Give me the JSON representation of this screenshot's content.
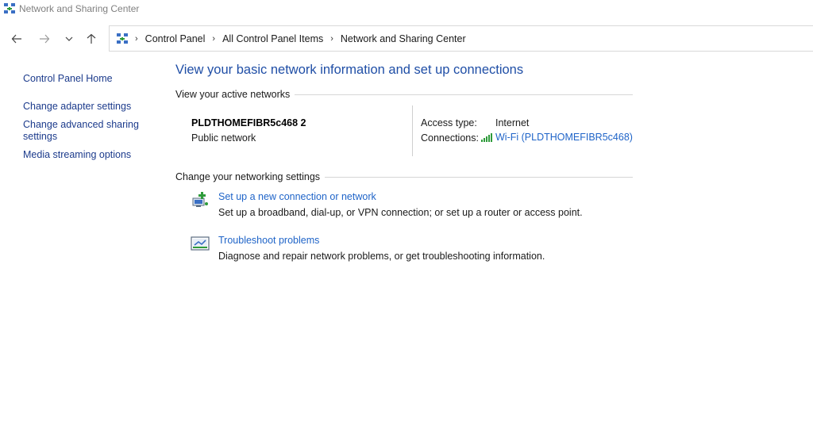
{
  "window": {
    "title": "Network and Sharing Center",
    "icon": "network-sharing-icon"
  },
  "nav": {
    "back_icon": "arrow-left-icon",
    "forward_icon": "arrow-right-icon",
    "recent_icon": "chevron-down-icon",
    "up_icon": "arrow-up-icon"
  },
  "breadcrumb": {
    "items": [
      "Control Panel",
      "All Control Panel Items",
      "Network and Sharing Center"
    ],
    "separator": "›"
  },
  "sidebar": {
    "items": [
      {
        "label": "Control Panel Home"
      },
      {
        "label": "Change adapter settings"
      },
      {
        "label": "Change advanced sharing settings"
      },
      {
        "label": "Media streaming options"
      }
    ]
  },
  "main": {
    "title": "View your basic network information and set up connections",
    "active_networks": {
      "header": "View your active networks",
      "network_name": "PLDTHOMEFIBR5c468 2",
      "network_category": "Public network",
      "access_type_label": "Access type:",
      "access_type_value": "Internet",
      "connections_label": "Connections:",
      "connection_value": "Wi-Fi (PLDTHOMEFIBR5c468)"
    },
    "change_settings": {
      "header": "Change your networking settings",
      "tasks": [
        {
          "link": "Set up a new connection or network",
          "description": "Set up a broadband, dial-up, or VPN connection; or set up a router or access point.",
          "icon": "new-connection-icon"
        },
        {
          "link": "Troubleshoot problems",
          "description": "Diagnose and repair network problems, or get troubleshooting information.",
          "icon": "troubleshoot-icon"
        }
      ]
    }
  },
  "colors": {
    "link": "#1f64c8",
    "title": "#1f4ea6",
    "sidebar_link": "#1c3b8c",
    "wifi": "#2e9b3a"
  }
}
